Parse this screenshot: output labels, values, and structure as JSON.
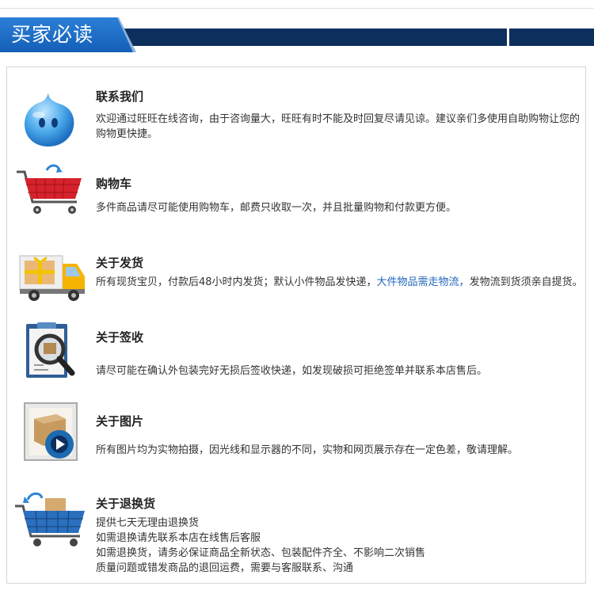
{
  "header": {
    "title": "买家必读"
  },
  "colors": {
    "header_bar": "#0d2f5e",
    "tab": "#1e6cc8",
    "highlight": "#2266bb"
  },
  "sections": [
    {
      "icon": "chat-bubble-icon",
      "title": "联系我们",
      "text": "欢迎通过旺旺在线咨询，由于咨询量大，旺旺有时不能及时回复尽请见谅。建议亲们多使用自助购物让您的购物更快捷。"
    },
    {
      "icon": "shopping-cart-icon",
      "title": "购物车",
      "text": "多件商品请尽可能使用购物车，邮费只收取一次，并且批量购物和付款更方便。"
    },
    {
      "icon": "delivery-truck-icon",
      "title": "关于发货",
      "text_before": "所有现货宝贝，付款后48小时内发货；默认小件物品发快递，",
      "text_highlight": "大件物品需走物流，",
      "text_after": "发物流到货须亲自提货。"
    },
    {
      "icon": "inspection-magnifier-icon",
      "title": "关于签收",
      "text": "请尽可能在确认外包装完好无损后签收快递，如发现破损可拒绝签单并联系本店售后。"
    },
    {
      "icon": "photo-frame-icon",
      "title": "关于图片",
      "text": "所有图片均为实物拍摄，因光线和显示器的不同，实物和网页展示存在一定色差，敬请理解。"
    },
    {
      "icon": "return-cart-icon",
      "title": "关于退换货",
      "lines": [
        "提供七天无理由退换货",
        "如需退换请先联系本店在线售后客服",
        "如需退换货，请务必保证商品全新状态、包装配件齐全、不影响二次销售",
        "质量问题或错发商品的退回运费，需要与客服联系、沟通"
      ]
    }
  ]
}
